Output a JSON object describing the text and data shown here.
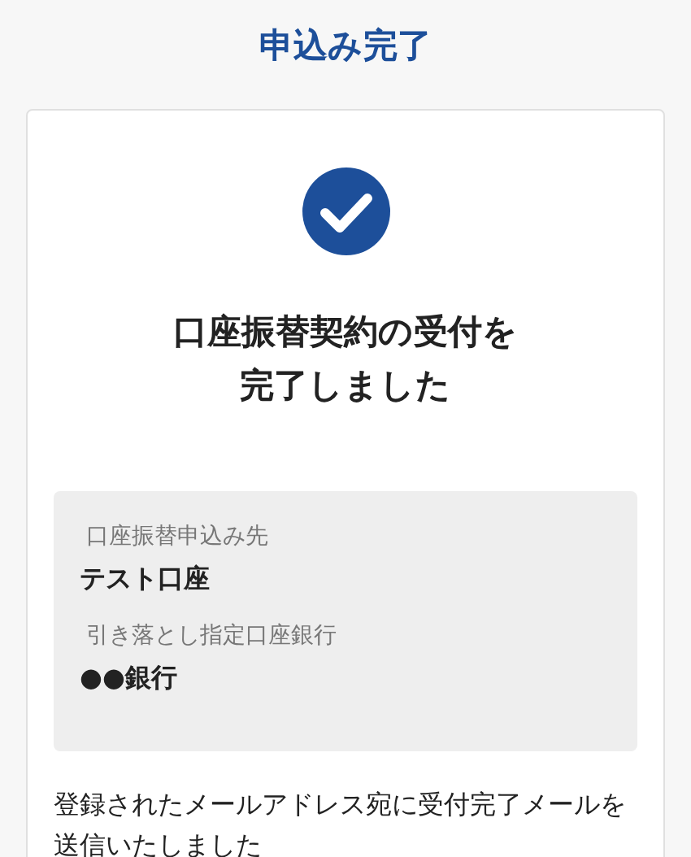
{
  "header": {
    "title": "申込み完了"
  },
  "card": {
    "completed": true,
    "message_lines": [
      "口座振替契約の受付を",
      "完了しました"
    ],
    "details": [
      {
        "label": "口座振替申込み先",
        "value": "テスト口座"
      },
      {
        "label": "引き落とし指定口座銀行",
        "value": "●●銀行"
      }
    ],
    "note": "登録されたメールアドレス宛に受付完了メールを送信いたしました"
  }
}
